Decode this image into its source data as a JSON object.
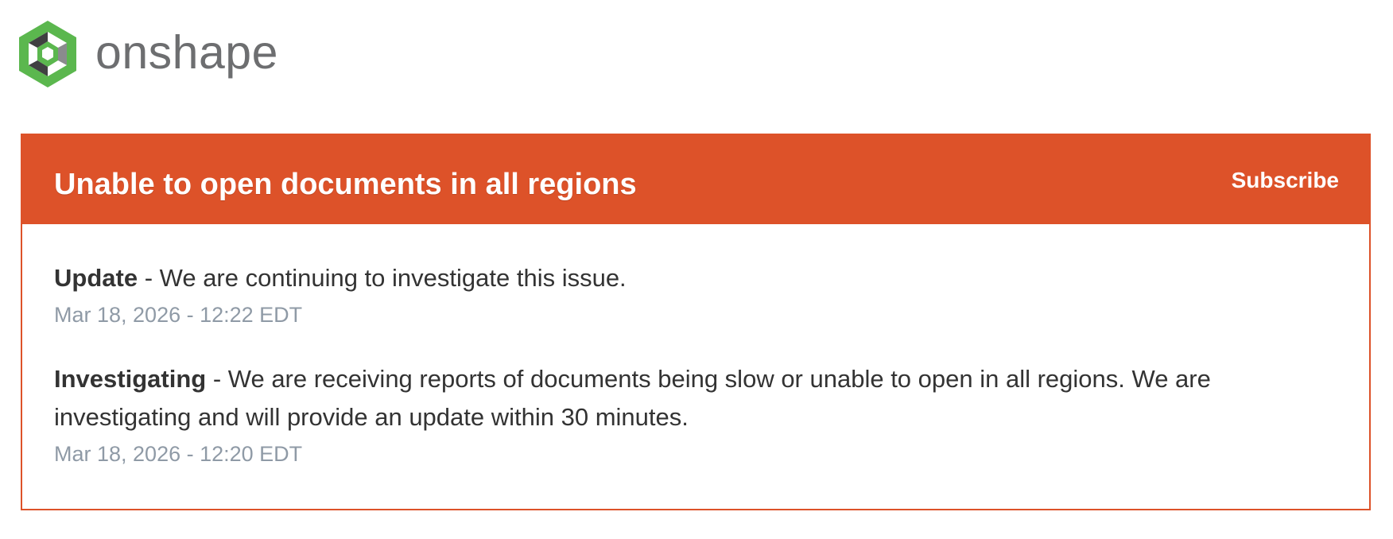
{
  "brand": {
    "name": "onshape",
    "logo_icon": "onshape-hexagon-logo-icon",
    "colors": {
      "logo_green": "#5bb74e",
      "wordmark_gray": "#6d6e70"
    }
  },
  "incident": {
    "title": "Unable to open documents in all regions",
    "subscribe_label": "Subscribe",
    "accent_color": "#dd5229",
    "updates": [
      {
        "status": "Update",
        "separator": " - ",
        "message": "We are continuing to investigate this issue.",
        "timestamp": "Mar 18, 2026 - 12:22 EDT"
      },
      {
        "status": "Investigating",
        "separator": " - ",
        "message": "We are receiving reports of documents being slow or unable to open in all regions. We are investigating and will provide an update within 30 minutes.",
        "timestamp": "Mar 18, 2026 - 12:20 EDT"
      }
    ]
  }
}
